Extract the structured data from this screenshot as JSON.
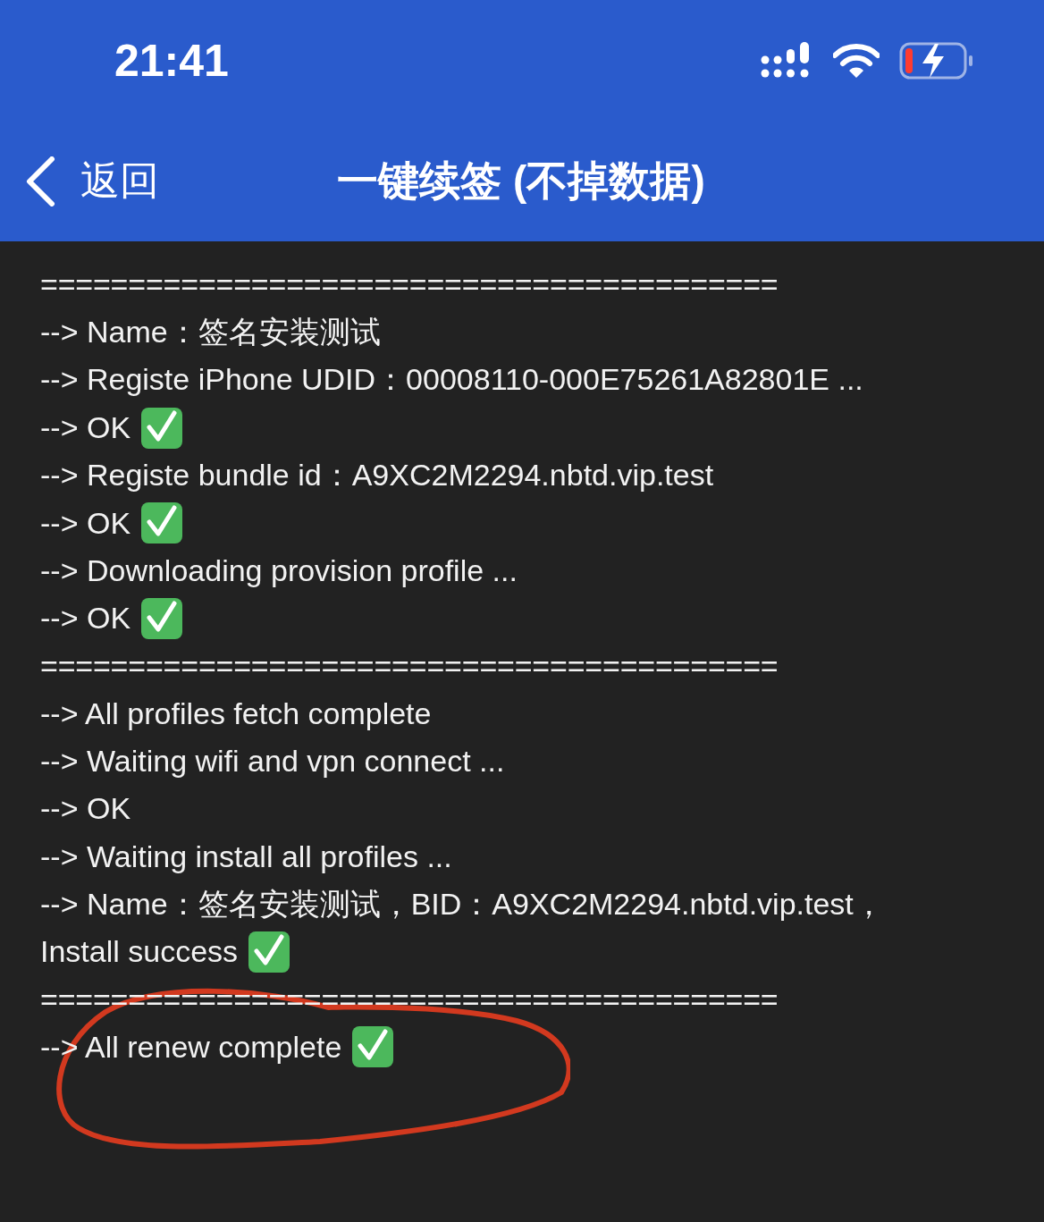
{
  "status_bar": {
    "time": "21:41"
  },
  "nav": {
    "back": "返回",
    "title": "一键续签 (不掉数据)"
  },
  "log": [
    {
      "kind": "separator",
      "text": "=========================================="
    },
    {
      "kind": "line",
      "text": "--> Name：签名安装测试",
      "check": false
    },
    {
      "kind": "line",
      "text": "--> Registe iPhone UDID：00008110-000E75261A82801E ...",
      "check": false
    },
    {
      "kind": "line",
      "text": "--> OK",
      "check": true
    },
    {
      "kind": "line",
      "text": "--> Registe bundle id：A9XC2M2294.nbtd.vip.test",
      "check": false
    },
    {
      "kind": "line",
      "text": "--> OK",
      "check": true
    },
    {
      "kind": "line",
      "text": "--> Downloading provision profile ...",
      "check": false
    },
    {
      "kind": "line",
      "text": "--> OK",
      "check": true
    },
    {
      "kind": "separator",
      "text": "=========================================="
    },
    {
      "kind": "line",
      "text": "--> All profiles fetch complete",
      "check": false
    },
    {
      "kind": "line",
      "text": "--> Waiting wifi and vpn connect ...",
      "check": false
    },
    {
      "kind": "line",
      "text": "--> OK",
      "check": false
    },
    {
      "kind": "line",
      "text": "--> Waiting install all profiles ...",
      "check": false
    },
    {
      "kind": "line",
      "text": "--> Name：签名安装测试，BID：A9XC2M2294.nbtd.vip.test，",
      "check": false
    },
    {
      "kind": "line",
      "text": "Install success",
      "check": true
    },
    {
      "kind": "separator",
      "text": "=========================================="
    },
    {
      "kind": "line",
      "text": "--> All renew complete",
      "check": true
    }
  ]
}
